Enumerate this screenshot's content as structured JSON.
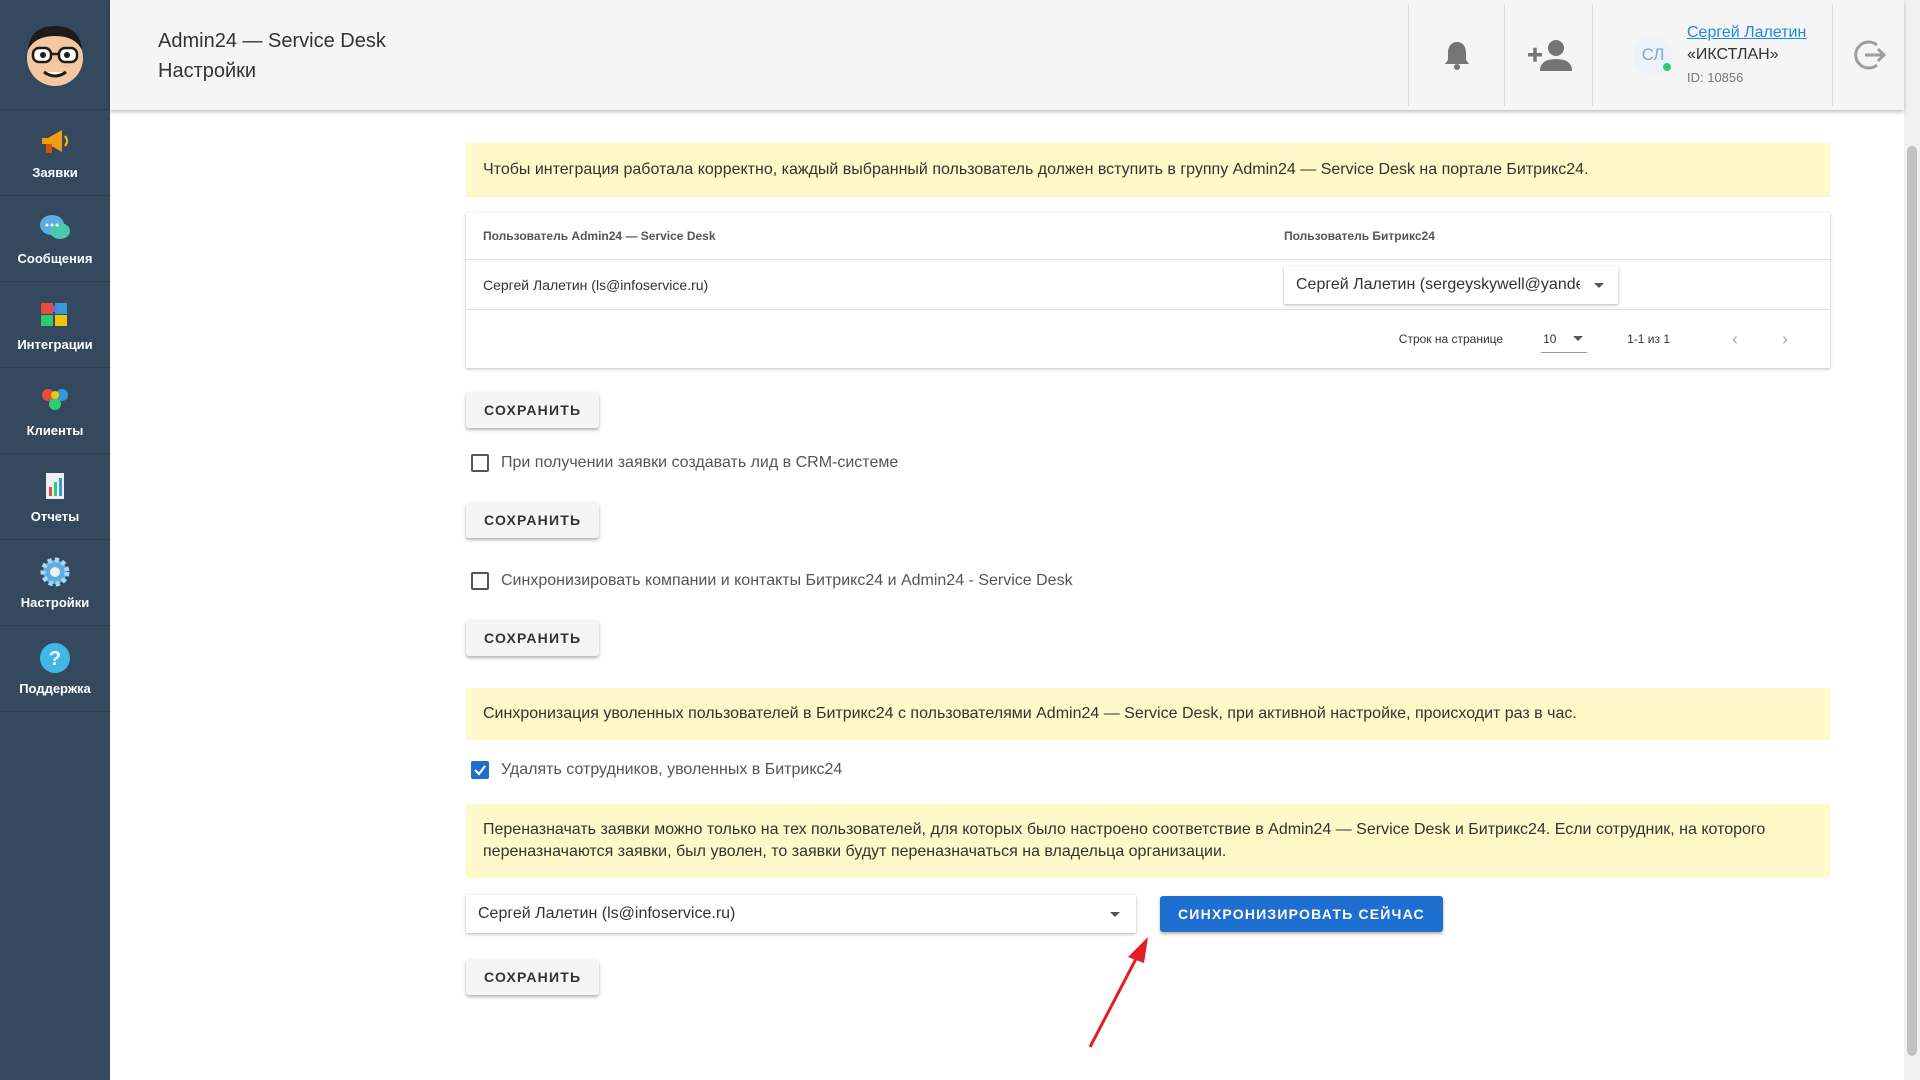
{
  "header": {
    "app_title": "Admin24 — Service Desk",
    "page_title": "Настройки",
    "user": {
      "initials": "СЛ",
      "name": "Сергей Лалетин",
      "org": "«ИКСТЛАН»",
      "id": "ID: 10856"
    }
  },
  "sidebar": {
    "items": [
      {
        "label": "Заявки",
        "icon": "megaphone-icon"
      },
      {
        "label": "Сообщения",
        "icon": "chat-icon"
      },
      {
        "label": "Интеграции",
        "icon": "puzzle-icon"
      },
      {
        "label": "Клиенты",
        "icon": "clients-icon"
      },
      {
        "label": "Отчеты",
        "icon": "report-icon"
      },
      {
        "label": "Настройки",
        "icon": "gear-icon"
      },
      {
        "label": "Поддержка",
        "icon": "help-icon"
      }
    ]
  },
  "integration": {
    "notice": "Чтобы интеграция работала корректно, каждый выбранный пользователь должен вступить в группу Admin24 — Service Desk на портале Битрикс24.",
    "table": {
      "col1": "Пользователь Admin24 — Service Desk",
      "col2": "Пользователь Битрикс24",
      "rows": [
        {
          "admin_user": "Сергей Лалетин (ls@infoservice.ru)",
          "bitrix_user": "Сергей Лалетин (sergeyskywell@yandex.ru)"
        }
      ],
      "rows_per_page_label": "Строк на странице",
      "rows_per_page": "10",
      "range": "1-1 из 1"
    },
    "save_label": "СОХРАНИТЬ",
    "lead_checkbox": "При получении заявки создавать лид в CRM-системе",
    "sync_checkbox": "Синхронизировать компании и контакты Битрикс24 и Admin24 - Service Desk",
    "fired_notice": "Синхронизация уволенных пользователей в Битрикс24 с пользователями Admin24 — Service Desk, при активной настройке, происходит раз в час.",
    "delete_checkbox": "Удалять сотрудников, уволенных в Битрикс24",
    "reassign_notice": "Переназначать заявки можно только на тех пользователей, для которых было настроено соответствие в Admin24 — Service Desk и Битрикс24. Если сотрудник, на которого переназначаются заявки, был уволен, то заявки будут переназначаться на владельца организации.",
    "owner_select": "Сергей Лалетин (ls@infoservice.ru)",
    "sync_now_label": "СИНХРОНИЗИРОВАТЬ СЕЙЧАС"
  },
  "colors": {
    "sidebar_bg": "#34495e",
    "notice_bg": "#fdf9c9",
    "primary": "#1e6fd0",
    "annotation_arrow": "#e31e24"
  }
}
